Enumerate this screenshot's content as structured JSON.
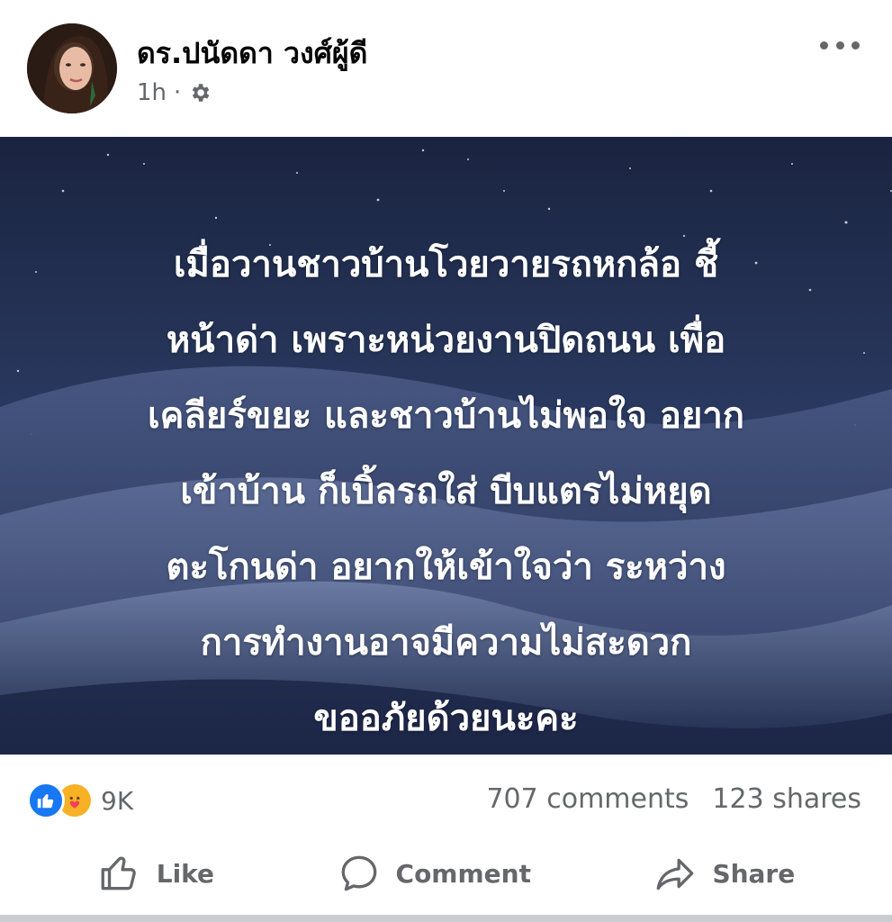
{
  "post": {
    "author": "ดร.ปนัดดา วงศ์ผู้ดี",
    "time": "1h",
    "separator": "·",
    "privacy_icon": "gear-icon",
    "more_icon": "more-icon",
    "quote_lines": [
      "เมื่อวานชาวบ้านโวยวายรถหกล้อ ชี้",
      "หน้าด่า เพราะหน่วยงานปิดถนน เพื่อ",
      "เคลียร์ขยะ และชาวบ้านไม่พอใจ อยาก",
      "เข้าบ้าน ก็เบิ้ลรถใส่ บีบแตรไม่หยุด",
      "ตะโกนด่า อยากให้เข้าใจว่า ระหว่าง",
      "การทำงานอาจมีความไม่สะดวก",
      "ขออภัยด้วยนะคะ"
    ]
  },
  "counts": {
    "reactions": "9K",
    "reaction_icons": [
      "like-icon",
      "care-icon"
    ],
    "comments": "707 comments",
    "shares": "123 shares"
  },
  "actions": {
    "like": "Like",
    "comment": "Comment",
    "share": "Share"
  },
  "colors": {
    "text_primary": "#050505",
    "text_secondary": "#65676b",
    "like_blue": "#1877f2",
    "care_yellow": "#f7b125",
    "image_bg": "#263455"
  }
}
